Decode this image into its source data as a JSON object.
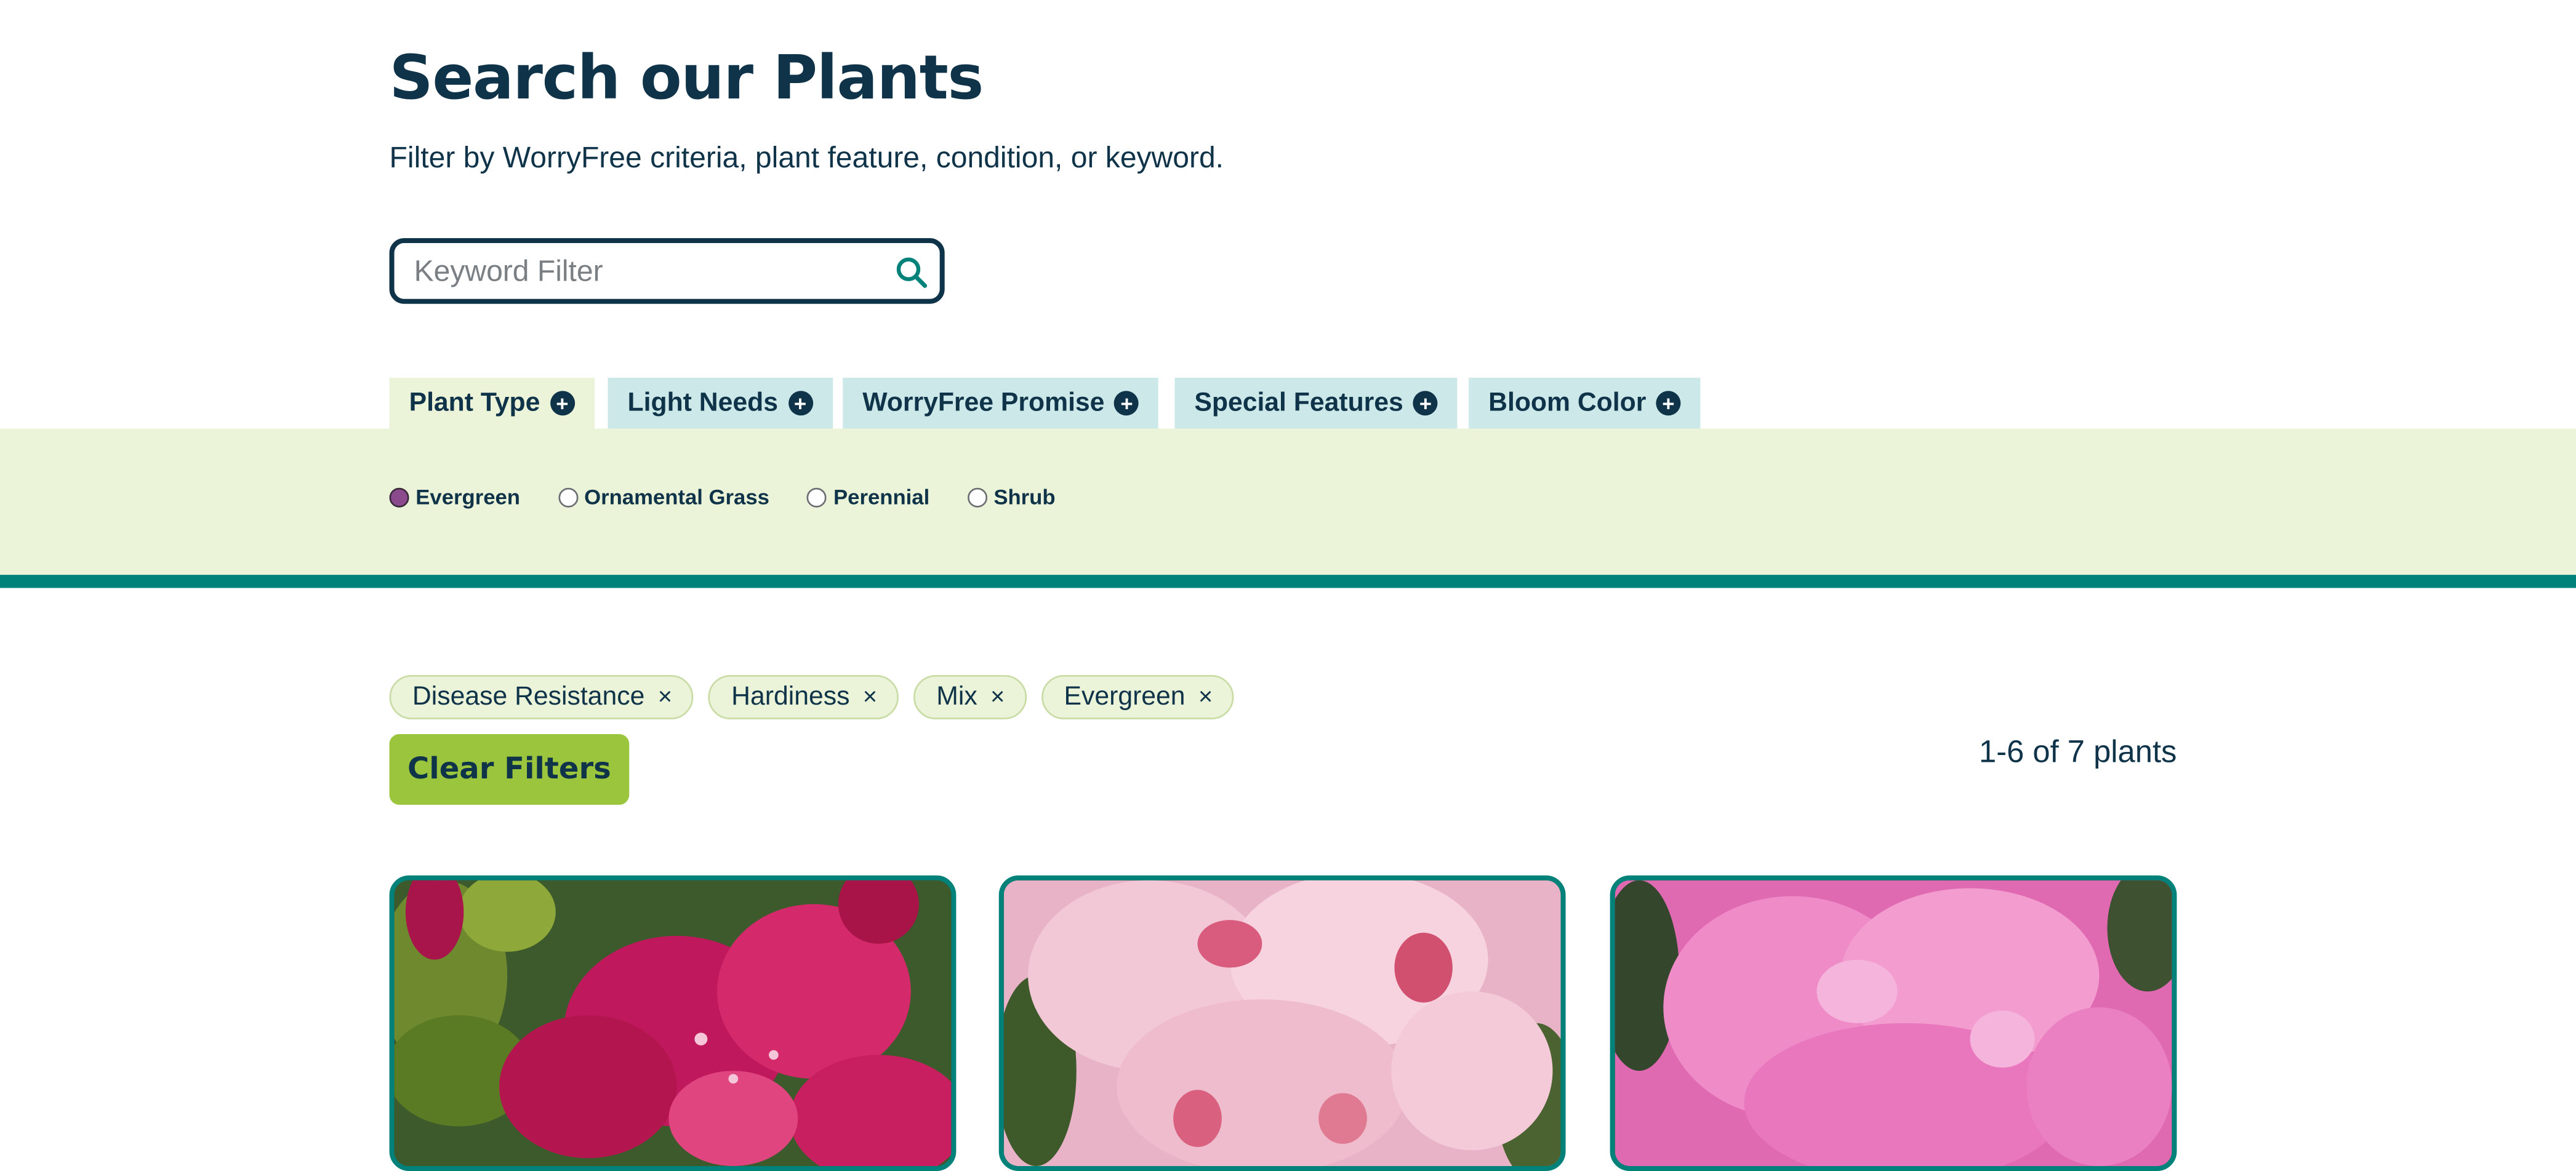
{
  "header": {
    "title": "Search our Plants",
    "subtitle": "Filter by WorryFree criteria, plant feature, condition, or keyword."
  },
  "search": {
    "placeholder": "Keyword Filter",
    "value": "",
    "icon": "search-icon"
  },
  "filter_tabs": [
    {
      "label": "Plant Type",
      "icon": "plus-circle-icon",
      "active": true
    },
    {
      "label": "Light Needs",
      "icon": "plus-circle-icon",
      "active": false
    },
    {
      "label": "WorryFree Promise",
      "icon": "plus-circle-icon",
      "active": false
    },
    {
      "label": "Special Features",
      "icon": "plus-circle-icon",
      "active": false
    },
    {
      "label": "Bloom Color",
      "icon": "plus-circle-icon",
      "active": false
    }
  ],
  "plant_type_options": [
    {
      "label": "Evergreen",
      "checked": true
    },
    {
      "label": "Ornamental Grass",
      "checked": false
    },
    {
      "label": "Perennial",
      "checked": false
    },
    {
      "label": "Shrub",
      "checked": false
    }
  ],
  "active_filters": [
    {
      "label": "Disease Resistance",
      "remove": "×"
    },
    {
      "label": "Hardiness",
      "remove": "×"
    },
    {
      "label": "Mix",
      "remove": "×"
    },
    {
      "label": "Evergreen",
      "remove": "×"
    }
  ],
  "clear_filters_label": "Clear Filters",
  "results_count": "1-6 of 7 plants",
  "plant_cards": [
    {
      "image": "magenta-rhododendron-photo"
    },
    {
      "image": "light-pink-rhododendron-photo"
    },
    {
      "image": "pink-rhododendron-photo"
    }
  ],
  "colors": {
    "navy": "#0f3349",
    "teal": "#00817a",
    "tab_bg": "#cde8e9",
    "panel_bg": "#ebf3d8",
    "clear_button": "#9bc53d",
    "radio_checked": "#8b4a8b"
  }
}
